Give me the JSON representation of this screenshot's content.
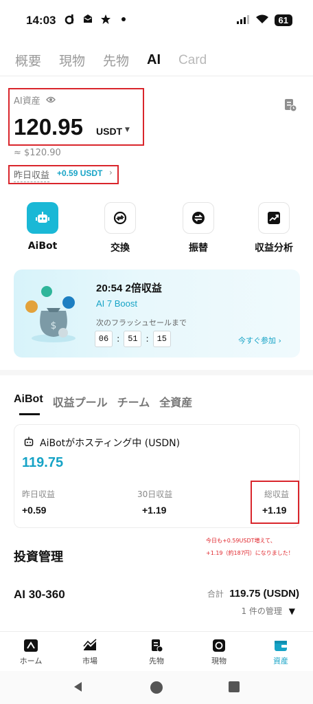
{
  "status_bar": {
    "time": "14:03",
    "battery": "61"
  },
  "top_tabs": [
    "概要",
    "現物",
    "先物",
    "AI",
    "Card"
  ],
  "asset": {
    "label": "AI資産",
    "value": "120.95",
    "unit": "USDT",
    "approx": "≈ $120.90",
    "yesterday_label": "昨日収益",
    "yesterday_value": "+0.59 USDT"
  },
  "quick_actions": [
    "AiBot",
    "交換",
    "振替",
    "収益分析"
  ],
  "promo": {
    "title": "20:54  2倍収益",
    "subtitle": "AI 7 Boost",
    "until_label": "次のフラッシュセールまで",
    "timer": [
      "06",
      "51",
      "15"
    ],
    "join_label": "今すぐ参加"
  },
  "sub_tabs": [
    "AiBot",
    "収益プール",
    "チーム",
    "全資産"
  ],
  "card": {
    "title": "AiBotがホスティング中 (USDN)",
    "amount": "119.75",
    "stats": [
      {
        "label": "昨日収益",
        "value": "+0.59"
      },
      {
        "label": "30日収益",
        "value": "+1.19"
      },
      {
        "label": "総収益",
        "value": "+1.19"
      }
    ]
  },
  "annotation": {
    "line1": "今日も+0.59USDT増えて、",
    "line2": "+1.19（約187円）になりました！"
  },
  "invest": {
    "title": "投資管理",
    "plan_name": "AI 30-360",
    "total_label": "合計",
    "total_value": "119.75 (USDN)",
    "manage_label": "1 件の管理"
  },
  "bottom_nav": [
    "ホーム",
    "市場",
    "先物",
    "現物",
    "資産"
  ],
  "colors": {
    "accent": "#16a3c6",
    "highlight_box": "#d9252b"
  }
}
